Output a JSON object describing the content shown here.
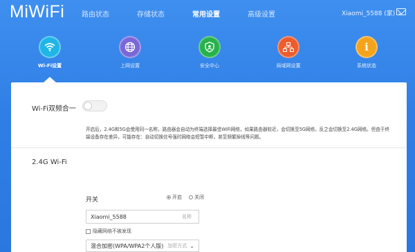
{
  "brand": "MiWiFi",
  "nav": {
    "items": [
      {
        "label": "路由状态",
        "active": false
      },
      {
        "label": "存储状态",
        "active": false
      },
      {
        "label": "常用设置",
        "active": true
      },
      {
        "label": "高级设置",
        "active": false
      }
    ]
  },
  "user": {
    "label": "Xiaomi_5588 (家)",
    "chevron": "chevron-down-icon"
  },
  "icons": [
    {
      "label": "Wi-Fi设置",
      "icon": "wifi-icon",
      "color": "#1fb5e6",
      "glyph": "≈"
    },
    {
      "label": "上网设置",
      "icon": "globe-icon",
      "color": "#7a68d8",
      "glyph": "◍"
    },
    {
      "label": "安全中心",
      "icon": "shield-icon",
      "color": "#27b24b",
      "glyph": "⛨"
    },
    {
      "label": "局域网设置",
      "icon": "network-icon",
      "color": "#ee5c2c",
      "glyph": "⊞"
    },
    {
      "label": "系统状态",
      "icon": "info-icon",
      "color": "#f5a31a",
      "glyph": "i"
    }
  ],
  "panel": {
    "dual_band_title": "Wi-Fi双频合一",
    "dual_band_on": false,
    "description": "开启后，2.4G和5G会使用同一名称，路由器会自动为终端选择最佳WiFi网络，如果路由器较近，会切换至5G网络，反之会切换至2.4G网络。但由于终端设备存在差异，可能存在：自动切换信号强时网络会短暂中断，甚至频繁掉线等问题。",
    "section_24g_title": "2.4G Wi-Fi",
    "switch_label": "开关",
    "radio_on_label": "开启",
    "radio_off_label": "关闭",
    "ssid_value": "Xiaomi_5588",
    "ssid_hint": "名称",
    "hide_network_label": "隐藏网络不被发现",
    "encryption_value": "混合加密(WPA/WPA2个人版)",
    "encryption_hint": "加密方式"
  }
}
